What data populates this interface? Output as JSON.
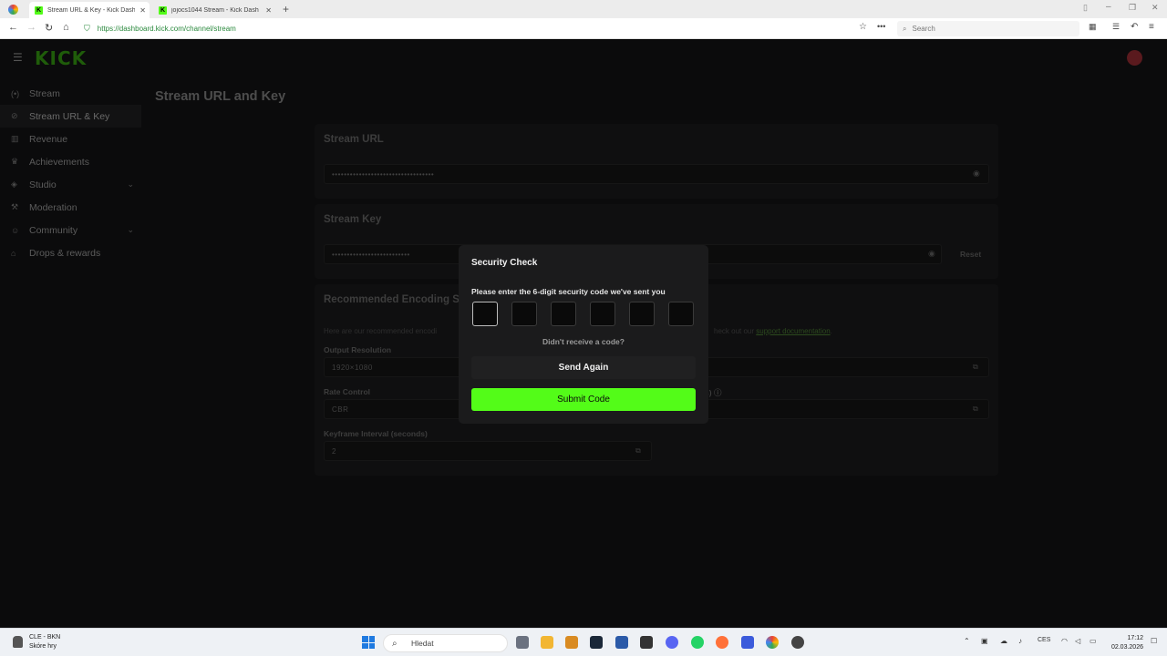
{
  "browser": {
    "tabs": [
      {
        "title": "Stream URL & Key - Kick Dash",
        "active": true
      },
      {
        "title": "jojocs1044 Stream - Kick Dash",
        "active": false
      }
    ],
    "url": "https://dashboard.kick.com/channel/stream",
    "search_placeholder": "Search"
  },
  "app": {
    "logo": "KICK",
    "sidebar": [
      {
        "label": "Stream",
        "icon": "broadcast-icon"
      },
      {
        "label": "Stream URL & Key",
        "icon": "link-icon",
        "active": true
      },
      {
        "label": "Revenue",
        "icon": "chart-icon"
      },
      {
        "label": "Achievements",
        "icon": "trophy-icon"
      },
      {
        "label": "Studio",
        "icon": "studio-icon",
        "expandable": true
      },
      {
        "label": "Moderation",
        "icon": "hammer-icon"
      },
      {
        "label": "Community",
        "icon": "users-icon",
        "expandable": true
      },
      {
        "label": "Drops & rewards",
        "icon": "gift-icon"
      }
    ],
    "page_title": "Stream URL and Key",
    "stream_url": {
      "title": "Stream URL",
      "value": "••••••••••••••••••••••••••••••••••"
    },
    "stream_key": {
      "title": "Stream Key",
      "value": "••••••••••••••••••••••••••",
      "reset": "Reset"
    },
    "encoding": {
      "title": "Recommended Encoding S",
      "desc_left": "Here are our recommended encodi",
      "desc_right_prefix": "heck out our ",
      "desc_link": "support documentation",
      "desc_end": ".",
      "output_resolution": {
        "label": "Output Resolution",
        "value": "1920×1080"
      },
      "rate_control": {
        "label": "Rate Control",
        "value": "CBR"
      },
      "bitrate_label_tail": "s)",
      "keyframe": {
        "label": "Keyframe Interval (seconds)",
        "value": "2"
      }
    }
  },
  "modal": {
    "title": "Security Check",
    "prompt": "Please enter the 6-digit security code we've sent you",
    "code_length": 6,
    "resend_question": "Didn't receive a code?",
    "send_again": "Send Again",
    "submit": "Submit Code"
  },
  "taskbar": {
    "weather_line1": "CLE - BKN",
    "weather_line2": "Skóre hry",
    "search": "Hledat",
    "lang": "CES",
    "time": "17:12",
    "date": "02.03.2026"
  },
  "colors": {
    "accent": "#53fc18"
  }
}
